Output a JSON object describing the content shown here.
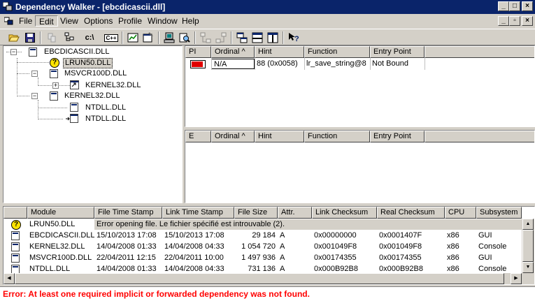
{
  "window": {
    "title": "Dependency Walker - [ebcdicascii.dll]",
    "caption_buttons": [
      "_",
      "□",
      "×"
    ],
    "mdi_buttons": [
      "_",
      "▫",
      "×"
    ]
  },
  "menu": {
    "items": [
      "File",
      "Edit",
      "View",
      "Options",
      "Profile",
      "Window",
      "Help"
    ],
    "selected": "Edit"
  },
  "toolbar": {
    "buttons": [
      "open-icon",
      "save-icon",
      "copy-icon",
      "fullpath-icon",
      "c-path-icon",
      "undecorate-cpp-icon",
      "auto-expand-icon",
      "properties-icon",
      "system-info-icon",
      "find-icon",
      "next-parent-icon",
      "prev-parent-icon",
      "matching-icon",
      "split-horizontal-icon",
      "split-vertical-icon",
      "help-icon"
    ],
    "c_path_label": "c:\\",
    "cpp_label": "C++"
  },
  "tree": {
    "nodes": [
      {
        "label": "EBCDICASCII.DLL",
        "icon": "module-icon"
      },
      {
        "label": "LRUN50.DLL",
        "icon": "question-icon",
        "selected": true
      },
      {
        "label": "MSVCR100D.DLL",
        "icon": "module-icon"
      },
      {
        "label": "KERNEL32.DLL",
        "icon": "forwarded-module-icon"
      },
      {
        "label": "KERNEL32.DLL",
        "icon": "module-icon"
      },
      {
        "label": "NTDLL.DLL",
        "icon": "module-icon"
      },
      {
        "label": "NTDLL.DLL",
        "icon": "forwarded-module-icon"
      }
    ]
  },
  "imports": {
    "columns": [
      "PI",
      "Ordinal ^",
      "Hint",
      "Function",
      "Entry Point"
    ],
    "rows": [
      {
        "pi": "",
        "ordinal": "N/A",
        "hint": "88 (0x0058)",
        "function": "lr_save_string@8",
        "entry_point": "Not Bound"
      }
    ]
  },
  "exports": {
    "columns": [
      "E",
      "Ordinal ^",
      "Hint",
      "Function",
      "Entry Point"
    ],
    "rows": []
  },
  "modules": {
    "columns": [
      "",
      "Module",
      "File Time Stamp",
      "Link Time Stamp",
      "File Size",
      "Attr.",
      "Link Checksum",
      "Real Checksum",
      "CPU",
      "Subsystem"
    ],
    "error_row": {
      "module": "LRUN50.DLL",
      "message": "Error opening file. Le fichier spécifié est introuvable (2)."
    },
    "rows": [
      {
        "module": "EBCDICASCII.DLL",
        "file_ts": "15/10/2013 17:08",
        "link_ts": "15/10/2013 17:08",
        "size": "29 184",
        "attr": "A",
        "link_cs": "0x00000000",
        "real_cs": "0x0001407F",
        "cpu": "x86",
        "subsystem": "GUI"
      },
      {
        "module": "KERNEL32.DLL",
        "file_ts": "14/04/2008 01:33",
        "link_ts": "14/04/2008 04:33",
        "size": "1 054 720",
        "attr": "A",
        "link_cs": "0x001049F8",
        "real_cs": "0x001049F8",
        "cpu": "x86",
        "subsystem": "Console"
      },
      {
        "module": "MSVCR100D.DLL",
        "file_ts": "22/04/2011 12:15",
        "link_ts": "22/04/2011 10:00",
        "size": "1 497 936",
        "attr": "A",
        "link_cs": "0x00174355",
        "real_cs": "0x00174355",
        "cpu": "x86",
        "subsystem": "GUI"
      },
      {
        "module": "NTDLL.DLL",
        "file_ts": "14/04/2008 01:33",
        "link_ts": "14/04/2008 04:33",
        "size": "731 136",
        "attr": "A",
        "link_cs": "0x000B92B8",
        "real_cs": "0x000B92B8",
        "cpu": "x86",
        "subsystem": "Console"
      }
    ]
  },
  "status": {
    "message": "Error: At least one required implicit or forwarded dependency was not found.",
    "color": "#ff0000"
  }
}
